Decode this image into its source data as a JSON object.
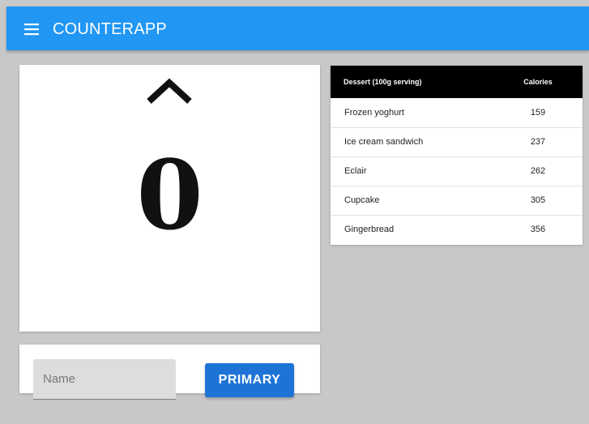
{
  "appbar": {
    "title": "COUNTERAPP",
    "menu_icon": "menu-icon",
    "color": "#2196f3"
  },
  "counter": {
    "increment_icon": "chevron-up-icon",
    "value": "0"
  },
  "form": {
    "name_placeholder": "Name",
    "name_value": "",
    "primary_button_label": "PRIMARY",
    "button_color": "#1e74d6"
  },
  "table": {
    "header_color": "#000000",
    "columns": [
      "Dessert (100g serving)",
      "Calories"
    ],
    "rows": [
      {
        "name": "Frozen yoghurt",
        "calories": "159"
      },
      {
        "name": "Ice cream sandwich",
        "calories": "237"
      },
      {
        "name": "Eclair",
        "calories": "262"
      },
      {
        "name": "Cupcake",
        "calories": "305"
      },
      {
        "name": "Gingerbread",
        "calories": "356"
      }
    ]
  }
}
